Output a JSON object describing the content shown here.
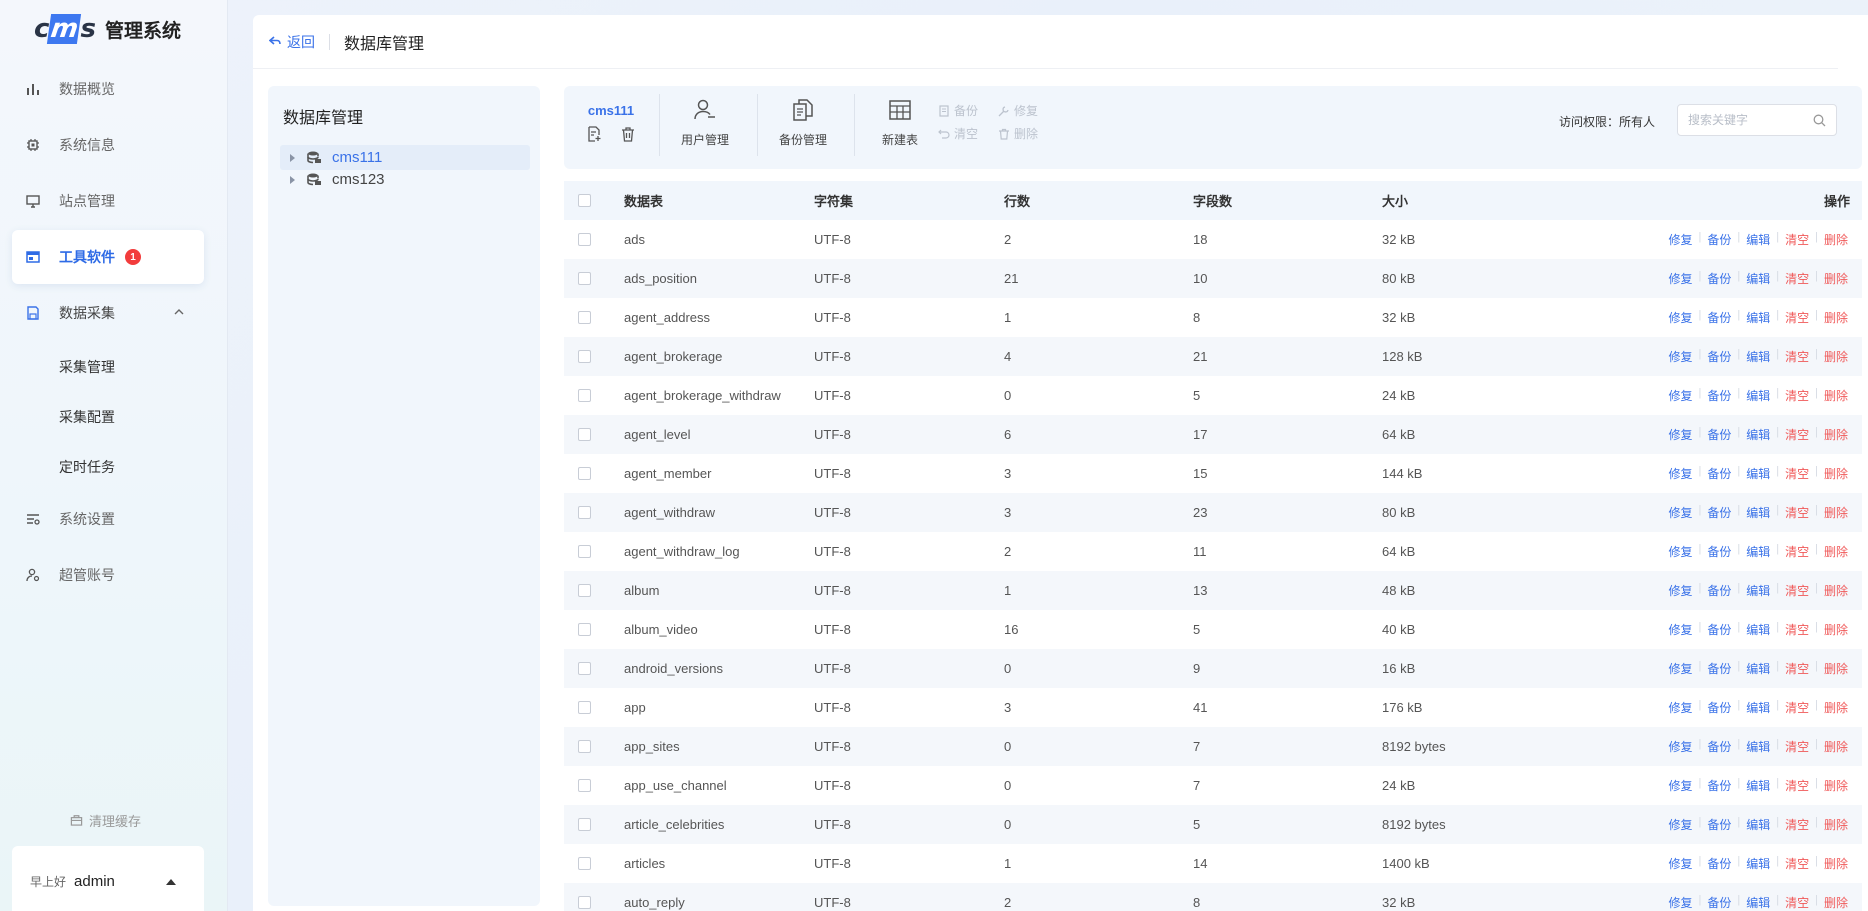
{
  "app": {
    "logo_text": "cms",
    "title": "管理系统"
  },
  "sidebar": {
    "items": [
      {
        "label": "数据概览",
        "icon": "bar-chart-icon"
      },
      {
        "label": "系统信息",
        "icon": "chip-icon"
      },
      {
        "label": "站点管理",
        "icon": "monitor-icon"
      },
      {
        "label": "工具软件",
        "icon": "window-icon",
        "active": true,
        "badge": "1"
      },
      {
        "label": "数据采集",
        "icon": "save-icon",
        "expanded": true
      }
    ],
    "sub_items": [
      "采集管理",
      "采集配置",
      "定时任务"
    ],
    "bottom_items": [
      {
        "label": "系统设置",
        "icon": "sliders-icon"
      },
      {
        "label": "超管账号",
        "icon": "user-gear-icon"
      }
    ],
    "clear_cache": "清理缓存",
    "user": {
      "greeting": "早上好",
      "name": "admin"
    }
  },
  "header": {
    "back_label": "返回",
    "title": "数据库管理"
  },
  "tree": {
    "title": "数据库管理",
    "nodes": [
      {
        "label": "cms111",
        "selected": true
      },
      {
        "label": "cms123",
        "selected": false
      }
    ]
  },
  "toolbar": {
    "db_name": "cms111",
    "user_mgmt": "用户管理",
    "backup_mgmt": "备份管理",
    "new_table": "新建表",
    "backup": "备份",
    "repair": "修复",
    "clear": "清空",
    "delete": "删除",
    "permission_label": "访问权限：所有人",
    "search_placeholder": "搜索关键字"
  },
  "table": {
    "columns": [
      "数据表",
      "字符集",
      "行数",
      "字段数",
      "大小",
      "操作"
    ],
    "actions": {
      "repair": "修复",
      "backup": "备份",
      "edit": "编辑",
      "clear": "清空",
      "delete": "删除"
    },
    "rows": [
      {
        "name": "ads",
        "charset": "UTF-8",
        "rows": "2",
        "fields": "18",
        "size": "32 kB"
      },
      {
        "name": "ads_position",
        "charset": "UTF-8",
        "rows": "21",
        "fields": "10",
        "size": "80 kB"
      },
      {
        "name": "agent_address",
        "charset": "UTF-8",
        "rows": "1",
        "fields": "8",
        "size": "32 kB"
      },
      {
        "name": "agent_brokerage",
        "charset": "UTF-8",
        "rows": "4",
        "fields": "21",
        "size": "128 kB"
      },
      {
        "name": "agent_brokerage_withdraw",
        "charset": "UTF-8",
        "rows": "0",
        "fields": "5",
        "size": "24 kB"
      },
      {
        "name": "agent_level",
        "charset": "UTF-8",
        "rows": "6",
        "fields": "17",
        "size": "64 kB"
      },
      {
        "name": "agent_member",
        "charset": "UTF-8",
        "rows": "3",
        "fields": "15",
        "size": "144 kB"
      },
      {
        "name": "agent_withdraw",
        "charset": "UTF-8",
        "rows": "3",
        "fields": "23",
        "size": "80 kB"
      },
      {
        "name": "agent_withdraw_log",
        "charset": "UTF-8",
        "rows": "2",
        "fields": "11",
        "size": "64 kB"
      },
      {
        "name": "album",
        "charset": "UTF-8",
        "rows": "1",
        "fields": "13",
        "size": "48 kB"
      },
      {
        "name": "album_video",
        "charset": "UTF-8",
        "rows": "16",
        "fields": "5",
        "size": "40 kB"
      },
      {
        "name": "android_versions",
        "charset": "UTF-8",
        "rows": "0",
        "fields": "9",
        "size": "16 kB"
      },
      {
        "name": "app",
        "charset": "UTF-8",
        "rows": "3",
        "fields": "41",
        "size": "176 kB"
      },
      {
        "name": "app_sites",
        "charset": "UTF-8",
        "rows": "0",
        "fields": "7",
        "size": "8192 bytes"
      },
      {
        "name": "app_use_channel",
        "charset": "UTF-8",
        "rows": "0",
        "fields": "7",
        "size": "24 kB"
      },
      {
        "name": "article_celebrities",
        "charset": "UTF-8",
        "rows": "0",
        "fields": "5",
        "size": "8192 bytes"
      },
      {
        "name": "articles",
        "charset": "UTF-8",
        "rows": "1",
        "fields": "14",
        "size": "1400 kB"
      },
      {
        "name": "auto_reply",
        "charset": "UTF-8",
        "rows": "2",
        "fields": "8",
        "size": "32 kB"
      }
    ]
  },
  "colors": {
    "accent": "#3a72e8",
    "danger": "#f05a5a",
    "badge": "#f23c3c"
  }
}
